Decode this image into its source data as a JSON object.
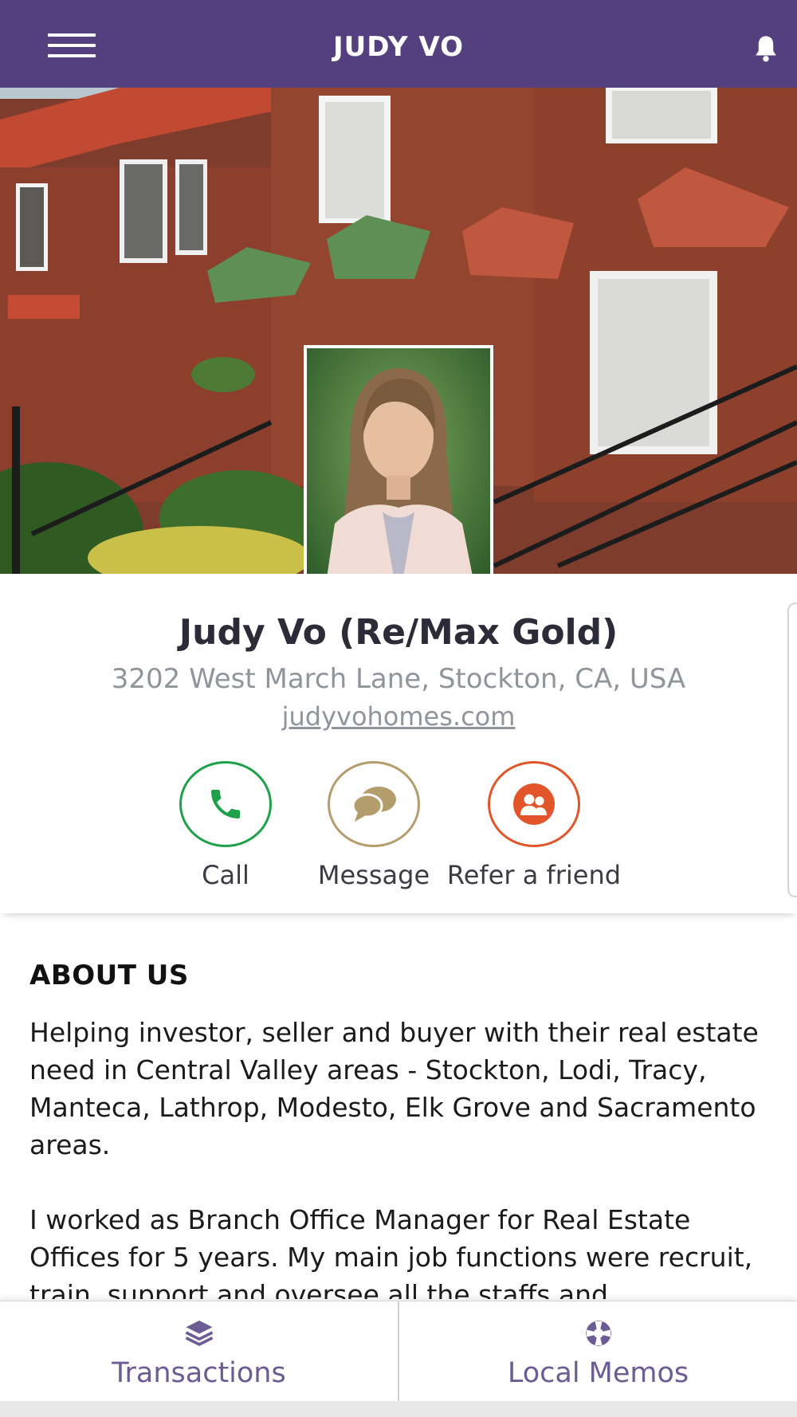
{
  "header": {
    "title": "JUDY VO"
  },
  "profile": {
    "name": "Judy Vo (Re/Max Gold)",
    "address": "3202 West March Lane, Stockton, CA, USA",
    "website": "judyvohomes.com"
  },
  "actions": {
    "call": "Call",
    "message": "Message",
    "refer": "Refer a friend"
  },
  "about": {
    "title": "ABOUT US",
    "paragraph1": "Helping investor, seller and buyer with their real estate need in Central Valley areas - Stockton, Lodi, Tracy, Manteca, Lathrop, Modesto, Elk Grove and Sacramento areas.",
    "paragraph2": "I worked as Branch Office Manager for Real Estate Offices for 5 years. My main job functions were recruit, train, support and oversee all the staffs and"
  },
  "bottom_nav": {
    "transactions": "Transactions",
    "local_memos": "Local Memos"
  },
  "colors": {
    "header": "#54407e",
    "call": "#1ea14a",
    "message": "#b49d6c",
    "refer": "#e2542a",
    "nav_text": "#6b5c93"
  },
  "icons": {
    "menu": "hamburger-menu-icon",
    "notification": "bell-icon",
    "call": "phone-icon",
    "message": "chat-bubbles-icon",
    "refer": "people-icon",
    "transactions": "layers-icon",
    "local_memos": "lifebuoy-icon"
  }
}
